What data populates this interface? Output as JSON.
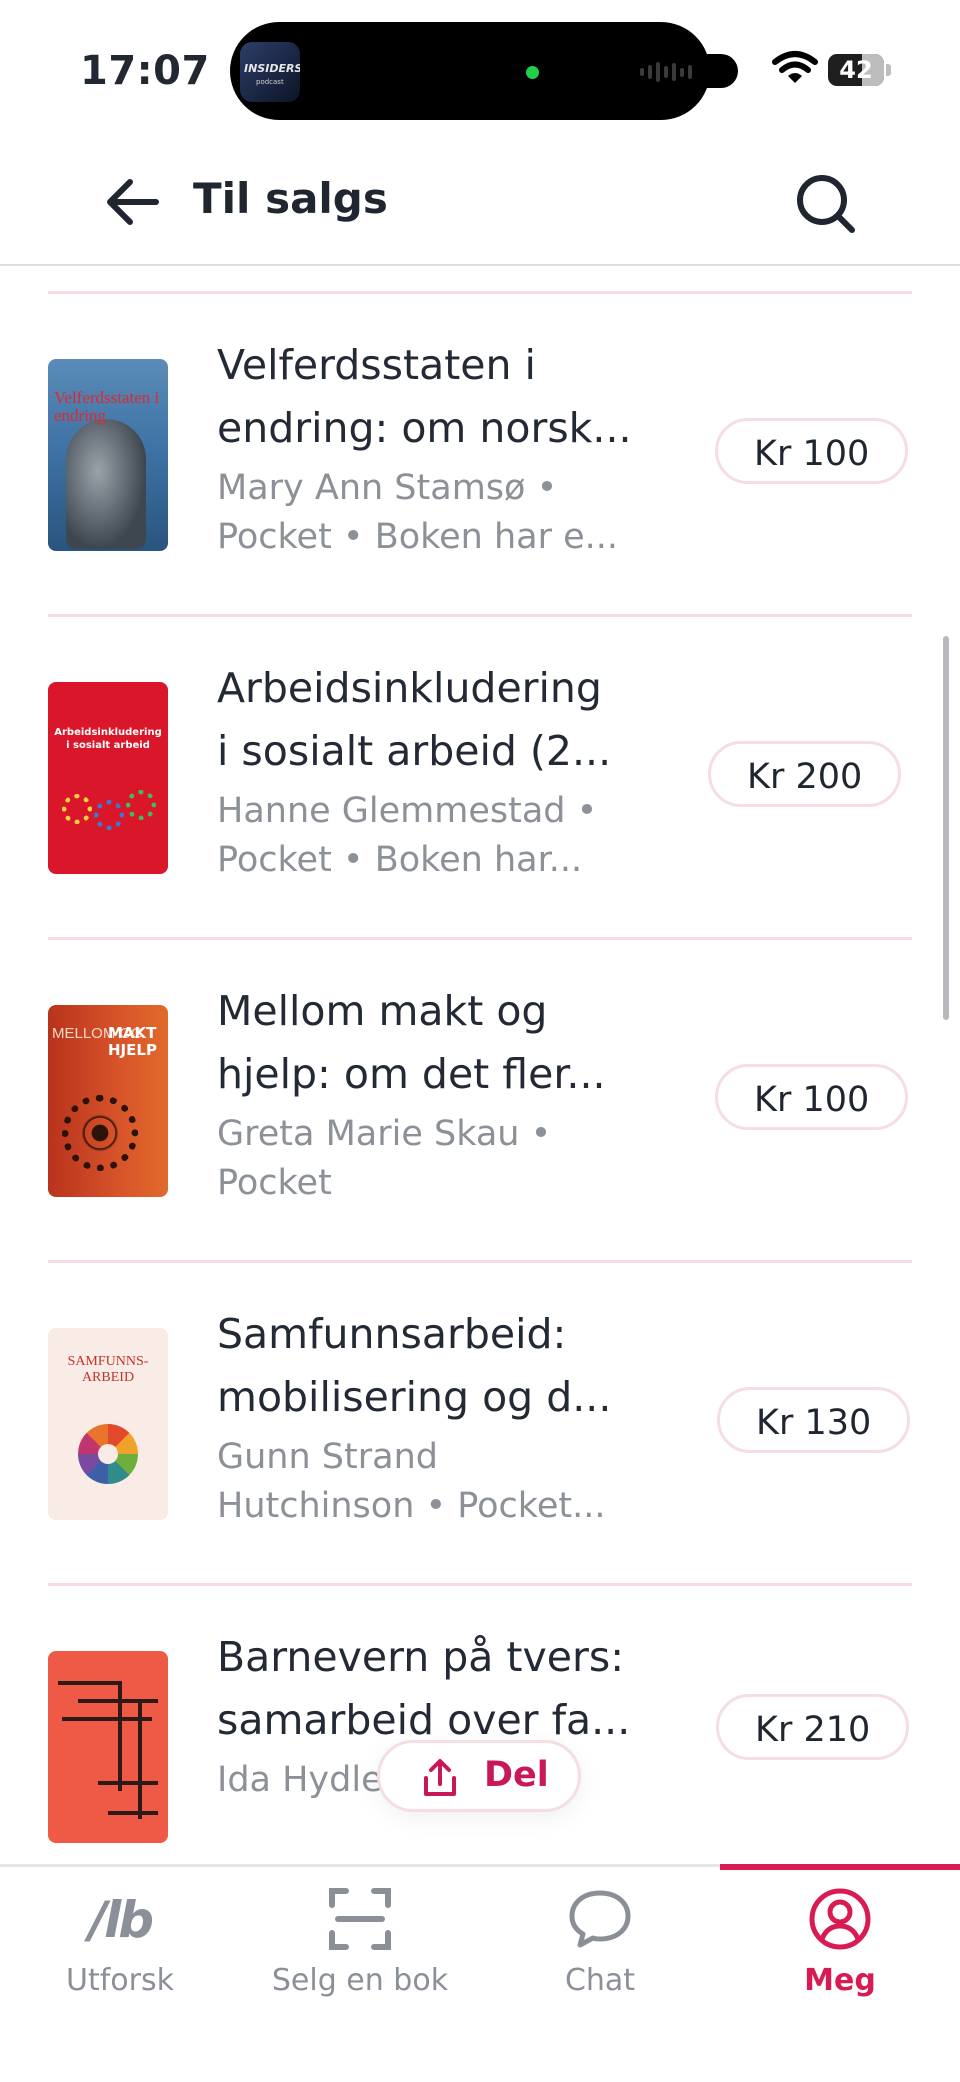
{
  "status_bar": {
    "time": "17:07",
    "battery": "42",
    "island_art_label": "INSIDERS",
    "island_art_sub": "podcast"
  },
  "header": {
    "title": "Til salgs",
    "back_icon": "arrow-left-icon",
    "search_icon": "search-icon"
  },
  "books": [
    {
      "title_line1": "Velferdsstaten i",
      "title_line2": "endring: om norsk...",
      "meta_line1": "Mary Ann Stamsø •",
      "meta_line2": "Pocket • Boken har e...",
      "price": "Kr 100",
      "cover_text": "Velferdsstaten i endring"
    },
    {
      "title_line1": "Arbeidsinkludering",
      "title_line2": "i sosialt arbeid (2...",
      "meta_line1": "Hanne Glemmestad •",
      "meta_line2": "Pocket • Boken har...",
      "price": "Kr 200",
      "cover_text": "Arbeidsinkludering i sosialt arbeid"
    },
    {
      "title_line1": "Mellom makt og",
      "title_line2": "hjelp: om det fler...",
      "meta_line1": "Greta Marie Skau •",
      "meta_line2": "Pocket",
      "price": "Kr 100",
      "cover_text_left": "MELLOM OG",
      "cover_text_right": "MAKT HJELP"
    },
    {
      "title_line1": "Samfunnsarbeid:",
      "title_line2": "mobilisering og d...",
      "meta_line1": "Gunn Strand",
      "meta_line2": "Hutchinson • Pocket...",
      "price": "Kr 130",
      "cover_text": "SAMFUNNS-ARBEID"
    },
    {
      "title_line1": "Barnevern på tvers:",
      "title_line2": "samarbeid over fa...",
      "meta_line1": "Ida Hydle",
      "meta_line2": "",
      "price": "Kr 210"
    }
  ],
  "share": {
    "label": "Del",
    "icon": "share-icon"
  },
  "bottom_nav": {
    "items": [
      {
        "label": "Utforsk",
        "icon": "lb-logo-icon",
        "logo_text": "/lb"
      },
      {
        "label": "Selg en bok",
        "icon": "scan-icon"
      },
      {
        "label": "Chat",
        "icon": "chat-bubble-icon"
      },
      {
        "label": "Meg",
        "icon": "profile-icon"
      }
    ],
    "active": "Meg"
  },
  "colors": {
    "accent": "#d81b52",
    "divider": "#f6dbe2",
    "muted_text": "#8c9198"
  }
}
